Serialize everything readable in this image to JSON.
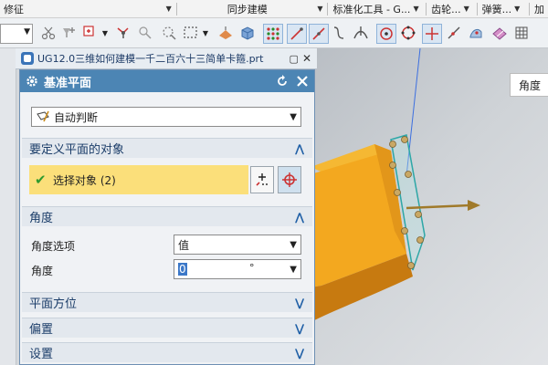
{
  "menubar": {
    "items": [
      {
        "label": "修征",
        "has_dropdown": true
      },
      {
        "label": "同步建模",
        "has_dropdown": true
      },
      {
        "label": "标准化工具 - G...",
        "has_dropdown": true
      },
      {
        "label": "齿轮...",
        "has_dropdown": true
      },
      {
        "label": "弹簧...",
        "has_dropdown": true
      },
      {
        "label": "加",
        "has_dropdown": false
      }
    ]
  },
  "document_tab": {
    "title": "UG12.0三维如何建模一千二百六十三简单卡箍.prt"
  },
  "viewport": {
    "angle_label": "角度"
  },
  "dialog": {
    "title": "基准平面",
    "type_selector": {
      "value": "自动判断"
    },
    "sections": {
      "objects": {
        "title": "要定义平面的对象",
        "expanded": true
      },
      "angle": {
        "title": "角度",
        "expanded": true
      },
      "plane_orientation": {
        "title": "平面方位",
        "expanded": false
      },
      "offset": {
        "title": "偏置",
        "expanded": false
      },
      "settings": {
        "title": "设置",
        "expanded": false
      }
    },
    "select_object": {
      "label": "选择对象 (2)"
    },
    "angle_option": {
      "label": "角度选项",
      "value": "值"
    },
    "angle_value": {
      "label": "角度",
      "value": "0",
      "unit": "°"
    }
  },
  "colors": {
    "dialog_header": "#4c85b4",
    "selection_highlight": "#fbdf7a",
    "part_face": "#f3a81f",
    "datum_plane": "#2fa7a7"
  }
}
